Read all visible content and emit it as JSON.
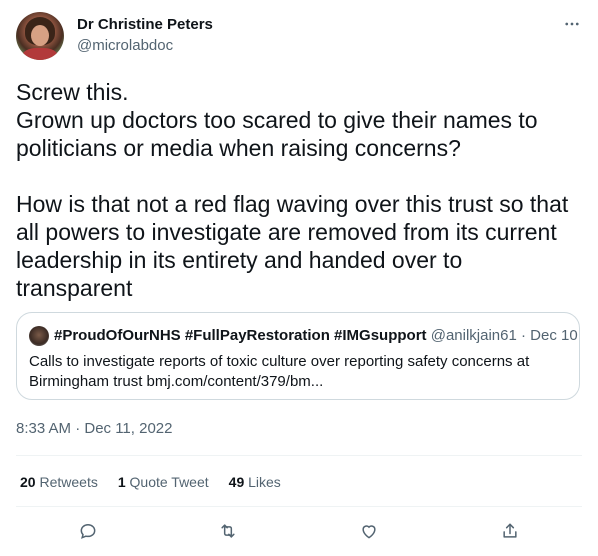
{
  "author": {
    "display_name": "Dr Christine Peters",
    "handle": "@microlabdoc"
  },
  "tweet": {
    "text": "Screw this.\nGrown up doctors too scared to give their names to politicians or media when raising concerns?\n\nHow is that not a red flag waving over this trust so that all powers to investigate are removed from its current leadership in its entirety and handed over to transparent",
    "timestamp": "8:33 AM · Dec 11, 2022"
  },
  "quoted_tweet": {
    "display_name": "#ProudOfOurNHS #FullPayRestoration #IMGsupport",
    "handle": "@anilkjain61",
    "date": "· Dec 10",
    "text": "Calls to investigate reports of toxic culture over reporting safety concerns at Birmingham trust bmj.com/content/379/bm..."
  },
  "stats": {
    "retweets_count": "20",
    "retweets_label": "Retweets",
    "quotes_count": "1",
    "quotes_label": "Quote Tweet",
    "likes_count": "49",
    "likes_label": "Likes"
  },
  "icons": {
    "more": "more-horizontal-icon",
    "reply": "reply-icon",
    "retweet": "retweet-icon",
    "like": "like-icon",
    "share": "share-icon"
  },
  "colors": {
    "text_primary": "#0f1419",
    "text_secondary": "#536471",
    "border": "#cfd9de"
  }
}
